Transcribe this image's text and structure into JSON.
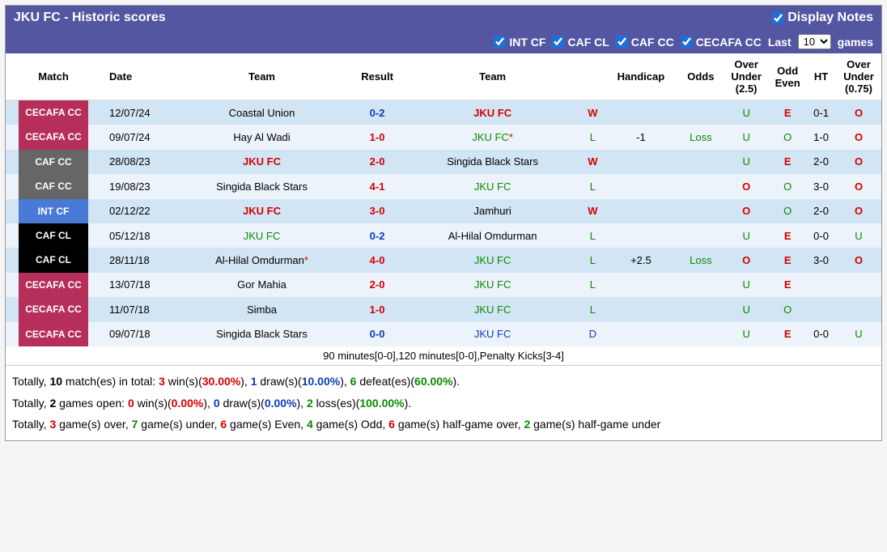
{
  "header": {
    "title": "JKU FC - Historic scores",
    "displayNotes": "Display Notes"
  },
  "filters": {
    "intcf": "INT CF",
    "cafcl": "CAF CL",
    "cafcc": "CAF CC",
    "cecafacc": "CECAFA CC",
    "lastPrefix": "Last",
    "lastSuffix": "games",
    "selected": "10"
  },
  "columns": {
    "match": "Match",
    "date": "Date",
    "team1": "Team",
    "result": "Result",
    "team2": "Team",
    "wl": "",
    "handicap": "Handicap",
    "odds": "Odds",
    "ou25": "Over Under (2.5)",
    "oe": "Odd Even",
    "ht": "HT",
    "ou075": "Over Under (0.75)"
  },
  "rows": [
    {
      "comp": "CECAFA CC",
      "compClass": "cecafa",
      "date": "12/07/24",
      "home": "Coastal Union",
      "homeColor": "black",
      "result": "0-2",
      "resultColor": "blue",
      "away": "JKU FC",
      "awayColor": "red",
      "awayStar": "",
      "wl": "W",
      "wlColor": "red",
      "handicap": "",
      "odds": "",
      "ou25": "U",
      "ou25Color": "green",
      "oe": "E",
      "oeColor": "red",
      "ht": "0-1",
      "ou075": "O",
      "ou075Color": "red"
    },
    {
      "comp": "CECAFA CC",
      "compClass": "cecafa",
      "date": "09/07/24",
      "home": "Hay Al Wadi",
      "homeColor": "black",
      "result": "1-0",
      "resultColor": "red",
      "away": "JKU FC",
      "awayColor": "green",
      "awayStar": "*",
      "wl": "L",
      "wlColor": "green",
      "handicap": "-1",
      "odds": "Loss",
      "ou25": "U",
      "ou25Color": "green",
      "oe": "O",
      "oeColor": "green",
      "ht": "1-0",
      "ou075": "O",
      "ou075Color": "red"
    },
    {
      "comp": "CAF CC",
      "compClass": "cafcc",
      "date": "28/08/23",
      "home": "JKU FC",
      "homeColor": "red",
      "result": "2-0",
      "resultColor": "red",
      "away": "Singida Black Stars",
      "awayColor": "black",
      "awayStar": "",
      "wl": "W",
      "wlColor": "red",
      "handicap": "",
      "odds": "",
      "ou25": "U",
      "ou25Color": "green",
      "oe": "E",
      "oeColor": "red",
      "ht": "2-0",
      "ou075": "O",
      "ou075Color": "red"
    },
    {
      "comp": "CAF CC",
      "compClass": "cafcc",
      "date": "19/08/23",
      "home": "Singida Black Stars",
      "homeColor": "black",
      "result": "4-1",
      "resultColor": "red",
      "away": "JKU FC",
      "awayColor": "green",
      "awayStar": "",
      "wl": "L",
      "wlColor": "green",
      "handicap": "",
      "odds": "",
      "ou25": "O",
      "ou25Color": "red",
      "oe": "O",
      "oeColor": "green",
      "ht": "3-0",
      "ou075": "O",
      "ou075Color": "red"
    },
    {
      "comp": "INT CF",
      "compClass": "intcf",
      "date": "02/12/22",
      "home": "JKU FC",
      "homeColor": "red",
      "result": "3-0",
      "resultColor": "red",
      "away": "Jamhuri",
      "awayColor": "black",
      "awayStar": "",
      "wl": "W",
      "wlColor": "red",
      "handicap": "",
      "odds": "",
      "ou25": "O",
      "ou25Color": "red",
      "oe": "O",
      "oeColor": "green",
      "ht": "2-0",
      "ou075": "O",
      "ou075Color": "red"
    },
    {
      "comp": "CAF CL",
      "compClass": "cafcl",
      "date": "05/12/18",
      "home": "JKU FC",
      "homeColor": "green",
      "result": "0-2",
      "resultColor": "blue",
      "away": "Al-Hilal Omdurman",
      "awayColor": "black",
      "awayStar": "",
      "wl": "L",
      "wlColor": "green",
      "handicap": "",
      "odds": "",
      "ou25": "U",
      "ou25Color": "green",
      "oe": "E",
      "oeColor": "red",
      "ht": "0-0",
      "ou075": "U",
      "ou075Color": "green"
    },
    {
      "comp": "CAF CL",
      "compClass": "cafcl",
      "date": "28/11/18",
      "home": "Al-Hilal Omdurman",
      "homeColor": "black",
      "homeStar": "*",
      "result": "4-0",
      "resultColor": "red",
      "away": "JKU FC",
      "awayColor": "green",
      "awayStar": "",
      "wl": "L",
      "wlColor": "green",
      "handicap": "+2.5",
      "odds": "Loss",
      "ou25": "O",
      "ou25Color": "red",
      "oe": "E",
      "oeColor": "red",
      "ht": "3-0",
      "ou075": "O",
      "ou075Color": "red"
    },
    {
      "comp": "CECAFA CC",
      "compClass": "cecafa",
      "date": "13/07/18",
      "home": "Gor Mahia",
      "homeColor": "black",
      "result": "2-0",
      "resultColor": "red",
      "away": "JKU FC",
      "awayColor": "green",
      "awayStar": "",
      "wl": "L",
      "wlColor": "green",
      "handicap": "",
      "odds": "",
      "ou25": "U",
      "ou25Color": "green",
      "oe": "E",
      "oeColor": "red",
      "ht": "",
      "ou075": "",
      "ou075Color": ""
    },
    {
      "comp": "CECAFA CC",
      "compClass": "cecafa",
      "date": "11/07/18",
      "home": "Simba",
      "homeColor": "black",
      "result": "1-0",
      "resultColor": "red",
      "away": "JKU FC",
      "awayColor": "green",
      "awayStar": "",
      "wl": "L",
      "wlColor": "green",
      "handicap": "",
      "odds": "",
      "ou25": "U",
      "ou25Color": "green",
      "oe": "O",
      "oeColor": "green",
      "ht": "",
      "ou075": "",
      "ou075Color": ""
    },
    {
      "comp": "CECAFA CC",
      "compClass": "cecafa",
      "date": "09/07/18",
      "home": "Singida Black Stars",
      "homeColor": "black",
      "result": "0-0",
      "resultColor": "blue",
      "away": "JKU FC",
      "awayColor": "blue",
      "awayStar": "",
      "wl": "D",
      "wlColor": "blue",
      "handicap": "",
      "odds": "",
      "ou25": "U",
      "ou25Color": "green",
      "oe": "E",
      "oeColor": "red",
      "ht": "0-0",
      "ou075": "U",
      "ou075Color": "green"
    }
  ],
  "footnote": "90 minutes[0-0],120 minutes[0-0],Penalty Kicks[3-4]",
  "summary": {
    "line1": {
      "p1": "Totally, ",
      "b1": "10",
      "p2": " match(es) in total: ",
      "r1": "3",
      "p3": " win(s)(",
      "r2": "30.00%",
      "p4": "), ",
      "bl1": "1",
      "p5": " draw(s)(",
      "bl2": "10.00%",
      "p6": "), ",
      "g1": "6",
      "p7": " defeat(es)(",
      "g2": "60.00%",
      "p8": ")."
    },
    "line2": {
      "p1": "Totally, ",
      "b1": "2",
      "p2": " games open: ",
      "r1": "0",
      "p3": " win(s)(",
      "r2": "0.00%",
      "p4": "), ",
      "bl1": "0",
      "p5": " draw(s)(",
      "bl2": "0.00%",
      "p6": "), ",
      "g1": "2",
      "p7": " loss(es)(",
      "g2": "100.00%",
      "p8": ")."
    },
    "line3": {
      "p1": "Totally, ",
      "r1": "3",
      "p2": " game(s) over, ",
      "g1": "7",
      "p3": " game(s) under, ",
      "r2": "6",
      "p4": " game(s) Even, ",
      "g2": "4",
      "p5": " game(s) Odd, ",
      "r3": "6",
      "p6": " game(s) half-game over, ",
      "g3": "2",
      "p7": " game(s) half-game under"
    }
  }
}
